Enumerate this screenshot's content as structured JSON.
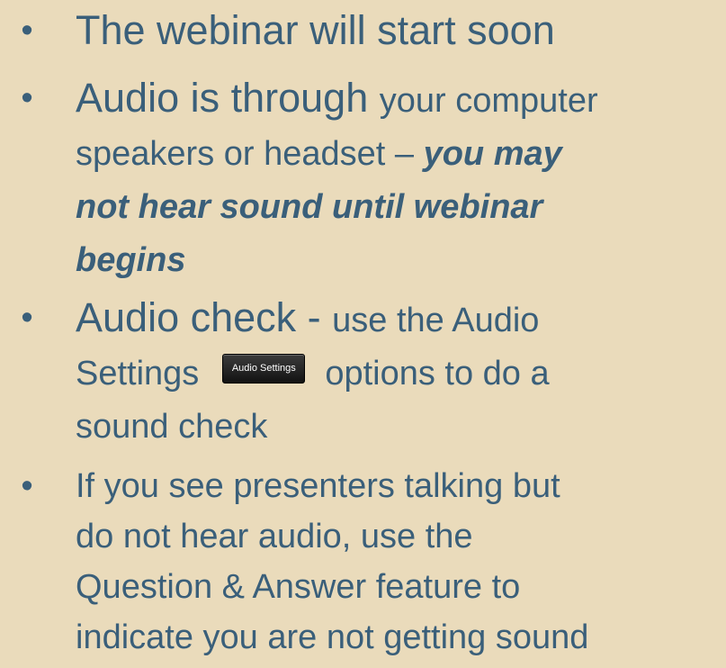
{
  "slide": {
    "bullet_symbol": "•",
    "items": [
      {
        "lines": [
          {
            "a": "The webinar will start soon"
          }
        ]
      },
      {
        "lines": [
          {
            "a": "Audio is through ",
            "b": "your computer"
          },
          {
            "a": "speakers or headset – ",
            "em": "you may"
          },
          {
            "em": "not hear sound until webinar"
          },
          {
            "em": "begins"
          }
        ]
      },
      {
        "lines": [
          {
            "a": "Audio check - ",
            "b": "use the Audio"
          },
          {
            "a": "Settings",
            "button": "Audio Settings",
            "c": "options to do a"
          },
          {
            "a": "sound check"
          }
        ]
      },
      {
        "lines": [
          {
            "a": "If you see presenters talking but"
          },
          {
            "a": "do not hear audio, use the"
          },
          {
            "a": "Question & Answer feature to"
          },
          {
            "a": "indicate you are not getting sound"
          }
        ]
      }
    ]
  }
}
